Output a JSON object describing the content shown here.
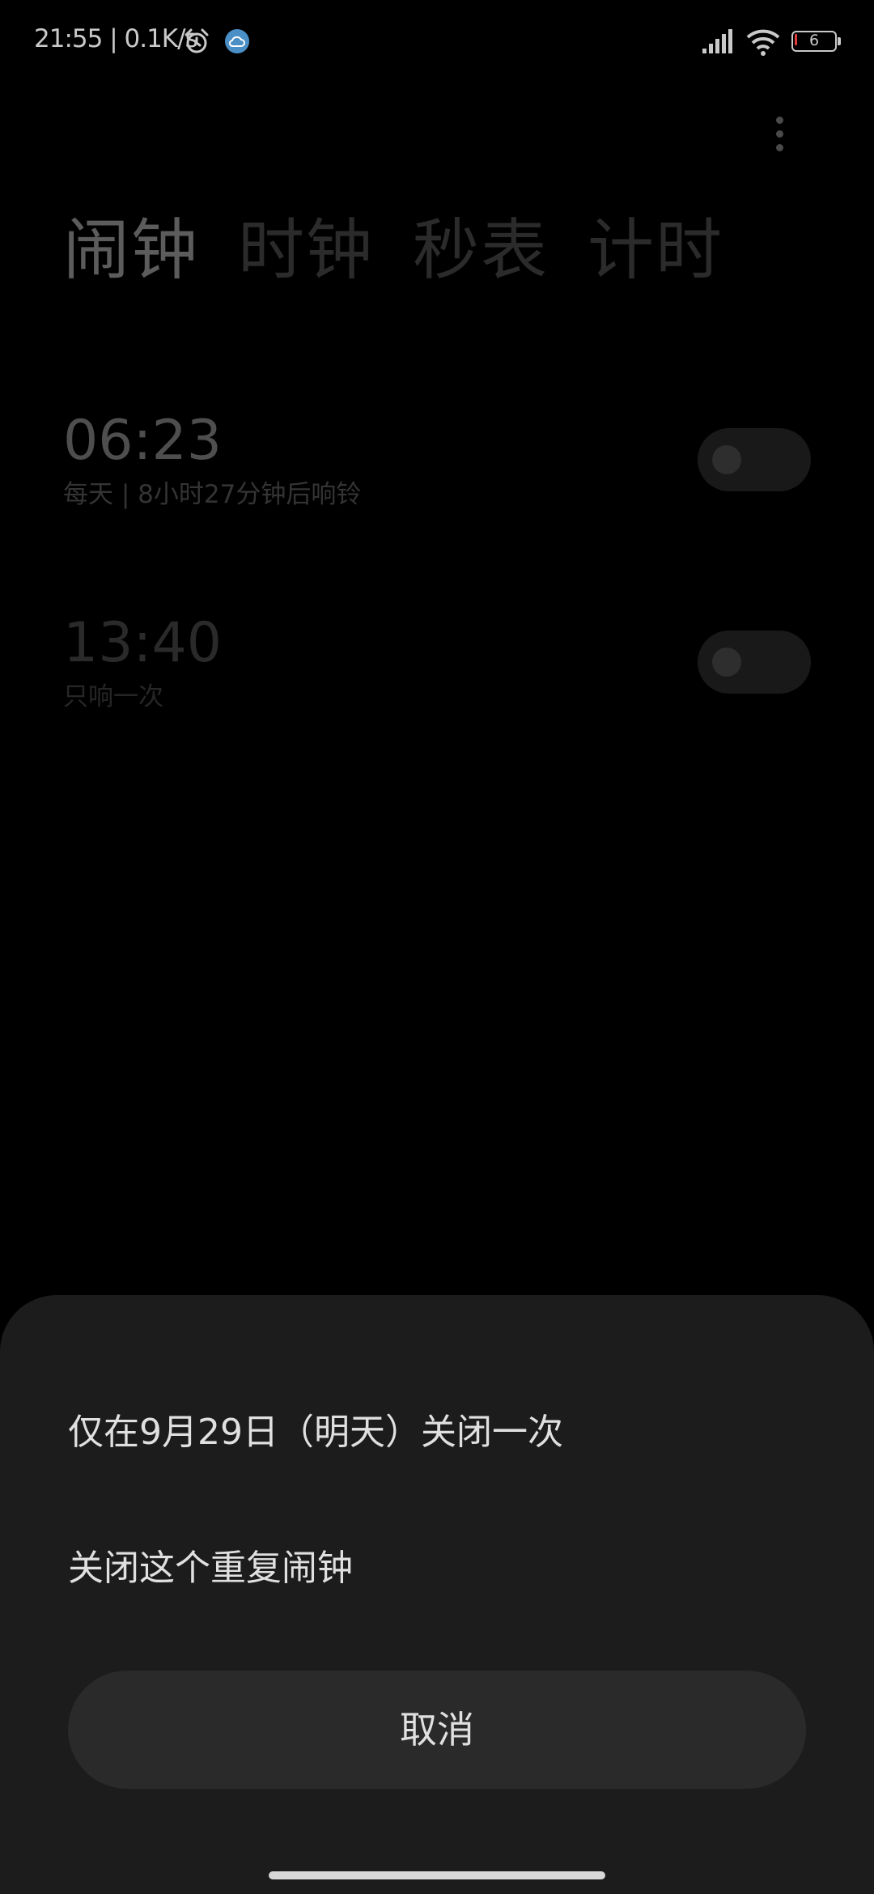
{
  "status_bar": {
    "time_speed": "21:55 | 0.1K/s",
    "battery_level": "6",
    "icons": [
      "alarm-icon",
      "cloud-icon",
      "signal-icon",
      "wifi-icon",
      "battery-icon"
    ]
  },
  "app": {
    "menu_icon": "more-vertical-icon",
    "tabs": [
      {
        "label": "闹钟",
        "active": true
      },
      {
        "label": "时钟",
        "active": false
      },
      {
        "label": "秒表",
        "active": false
      },
      {
        "label": "计时",
        "active": false
      }
    ],
    "alarms": [
      {
        "time": "06:23",
        "subtitle": "每天 | 8小时27分钟后响铃",
        "enabled": true
      },
      {
        "time": "13:40",
        "subtitle": "只响一次",
        "enabled": false
      }
    ]
  },
  "sheet": {
    "option_once": "仅在9月29日（明天）关闭一次",
    "option_repeat": "关闭这个重复闹钟",
    "cancel": "取消"
  }
}
